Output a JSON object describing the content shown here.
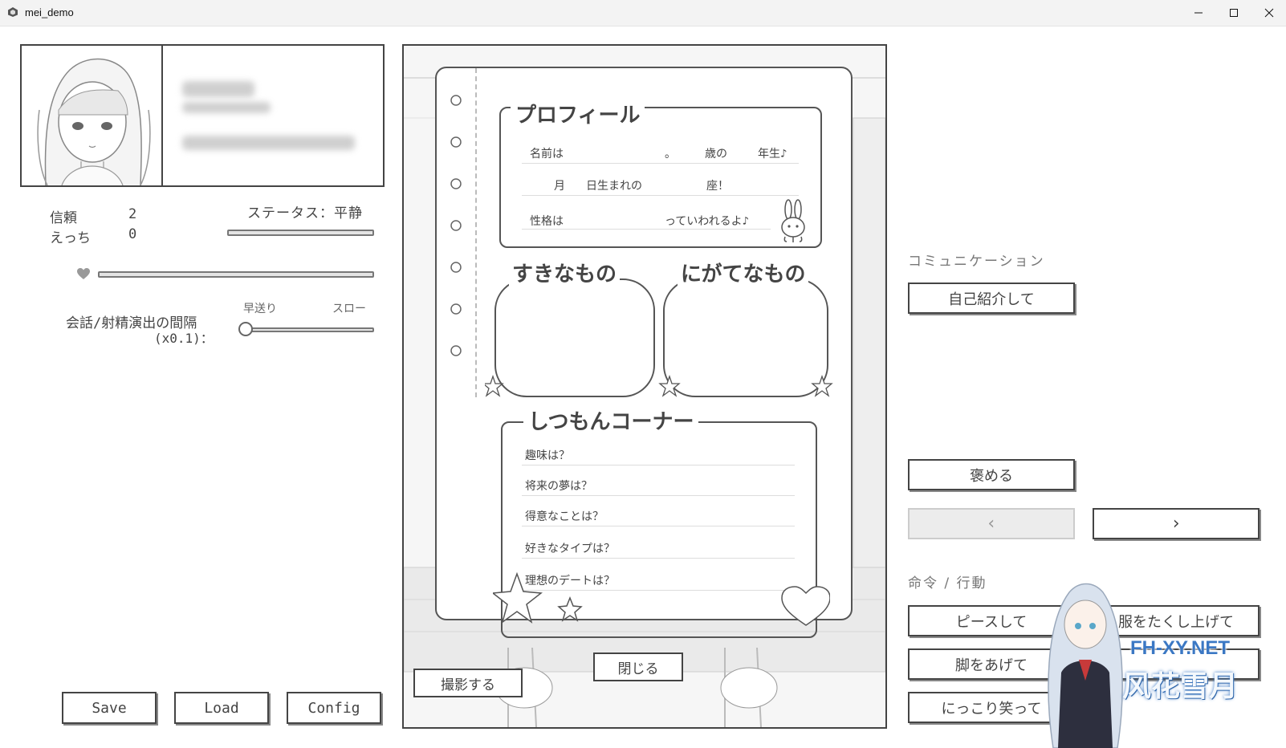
{
  "window": {
    "title": "mei_demo"
  },
  "status": {
    "trust_label": "信頼",
    "trust_value": "2",
    "ecchi_label": "えっち",
    "ecchi_value": "0",
    "status_text": "ステータス：平静"
  },
  "speed": {
    "label_line1": "会話/射精演出の間隔",
    "label_line2": "(x0.1)：",
    "fast_label": "早送り",
    "slow_label": "スロー"
  },
  "bottom_buttons": {
    "save": "Save",
    "load": "Load",
    "config": "Config"
  },
  "profile": {
    "title": "プロフィール",
    "row1_a": "名前は",
    "row1_b": "。",
    "row1_c": "歳の",
    "row1_d": "年生♪",
    "row2_a": "月",
    "row2_b": "日生まれの",
    "row2_c": "座！",
    "row3_a": "性格は",
    "row3_b": "っていわれるよ♪",
    "likes_title": "すきなもの",
    "dislikes_title": "にがてなもの",
    "qa_title": "しつもんコーナー",
    "questions": [
      "趣味は？",
      "将来の夢は？",
      "得意なことは？",
      "好きなタイプは？",
      "理想のデートは？"
    ],
    "close_button": "閉じる",
    "photo_button": "撮影する"
  },
  "communication": {
    "label": "コミュニケーション",
    "intro_button": "自己紹介して",
    "praise_button": "褒める",
    "prev_button": "‹",
    "next_button": "›"
  },
  "commands": {
    "label": "命令 / 行動",
    "peace_button": "ピースして",
    "lift_clothes_button": "服をたくし上げて",
    "legs_button": "脚をあげて",
    "smile_button": "にっこり笑って"
  },
  "watermark": {
    "site": "FH-XY.NET",
    "name": "风花雪月"
  }
}
